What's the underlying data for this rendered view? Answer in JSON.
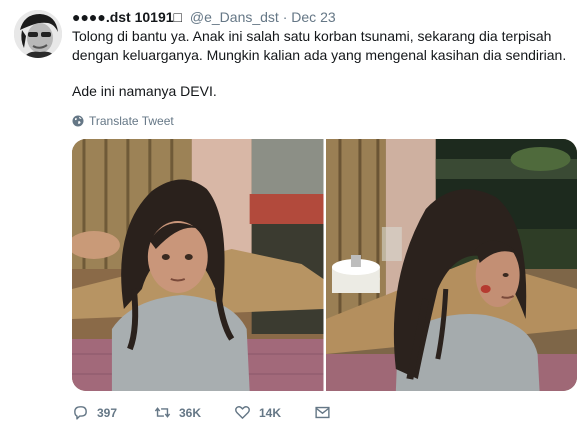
{
  "tweet": {
    "display_name": "●●●●.dst 10191□",
    "handle": "@e_Dans_dst",
    "separator": "·",
    "date": "Dec 23",
    "text_line_1": "Tolong di bantu ya. Anak ini salah satu korban tsunami, sekarang dia terpisah dengan keluarganya. Mungkin kalian ada yang mengenal kasihan dia sendirian.",
    "text_line_2": "Ade ini namanya DEVI.",
    "translate_label": "Translate Tweet",
    "stats": {
      "replies": "397",
      "retweets": "36K",
      "likes": "14K"
    }
  },
  "icons": {
    "translate": "globe-icon",
    "reply": "reply-icon",
    "retweet": "retweet-icon",
    "like": "heart-icon",
    "dm": "envelope-icon"
  },
  "colors": {
    "text_primary": "#14171a",
    "text_secondary": "#657786"
  }
}
